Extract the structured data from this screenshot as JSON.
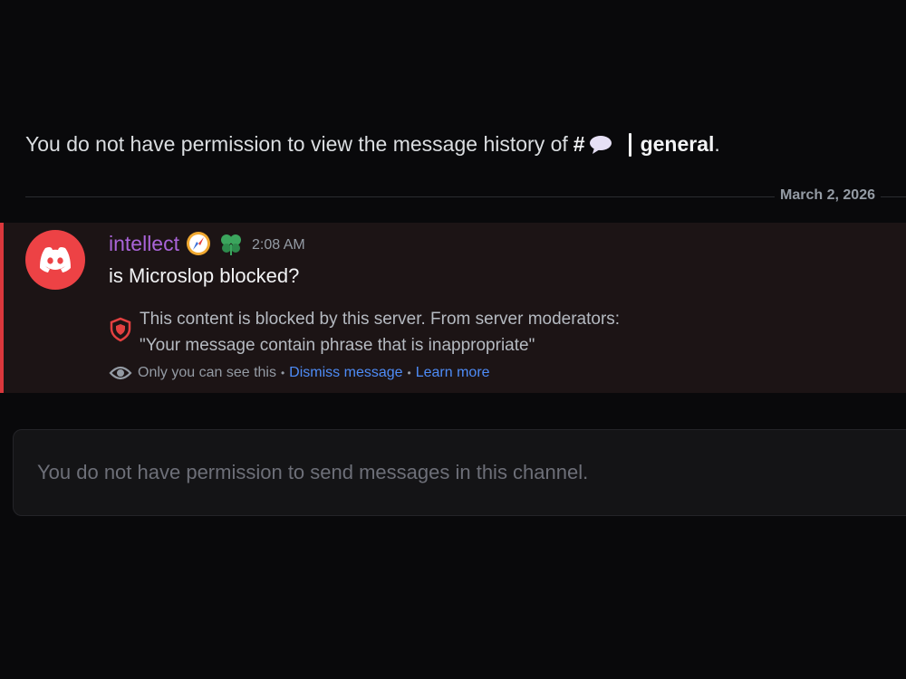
{
  "history_notice": {
    "prefix": "You do not have permission to view the message history of",
    "hash": "#",
    "channel": "general",
    "suffix": "."
  },
  "divider": {
    "date": "March 2, 2026"
  },
  "message": {
    "username": "intellect",
    "timestamp": "2:08 AM",
    "content": "is Microslop blocked?",
    "blocked_line1": "This content is blocked by this server. From server moderators:",
    "blocked_line2": "\"Your message contain phrase that is inappropriate\"",
    "ephemeral_text": "Only you can see this",
    "dismiss_label": "Dismiss message",
    "learn_more_label": "Learn more"
  },
  "composer": {
    "placeholder": "You do not have permission to send messages in this channel."
  },
  "colors": {
    "username": "#a964d8",
    "link": "#4e8cf7",
    "alert": "#da373c",
    "avatar_bg": "#ed4245"
  }
}
